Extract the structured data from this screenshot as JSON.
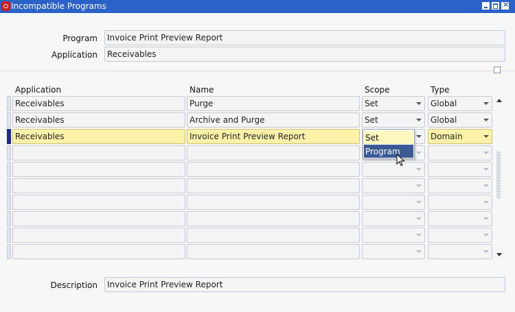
{
  "window": {
    "title": "Incompatible Programs"
  },
  "header": {
    "program_label": "Program",
    "program_value": "Invoice Print Preview Report",
    "application_label": "Application",
    "application_value": "Receivables"
  },
  "table": {
    "columns": [
      "Application",
      "Name",
      "Scope",
      "Type"
    ],
    "rows": [
      {
        "application": "Receivables",
        "name": "Purge",
        "scope": "Set",
        "type": "Global"
      },
      {
        "application": "Receivables",
        "name": "Archive and Purge",
        "scope": "Set",
        "type": "Global"
      },
      {
        "application": "Receivables",
        "name": "Invoice Print Preview Report",
        "scope": "",
        "type": "Domain"
      }
    ],
    "empty_row_count": 7
  },
  "scope_dropdown": {
    "options": [
      "Set",
      "Program"
    ],
    "highlighted": "Program"
  },
  "footer": {
    "description_label": "Description",
    "description_value": "Invoice Print Preview Report"
  },
  "colors": {
    "title_bar": "#2a62c9",
    "active_field": "#fff2a8",
    "highlight": "#3b5a96"
  }
}
